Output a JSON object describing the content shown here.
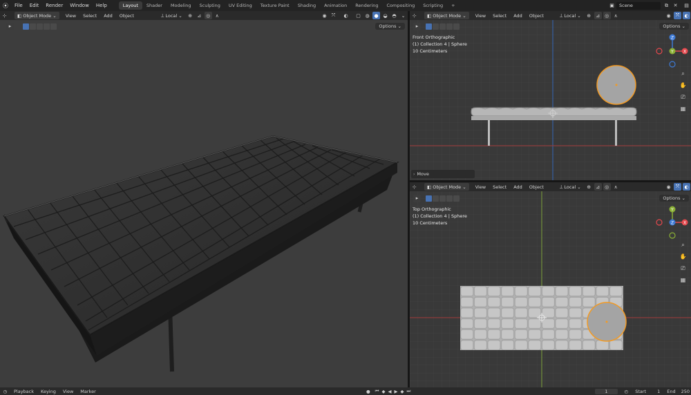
{
  "topbar": {
    "menus": [
      "File",
      "Edit",
      "Render",
      "Window",
      "Help"
    ],
    "workspaces": [
      "Layout",
      "Shader",
      "Modeling",
      "Sculpting",
      "UV Editing",
      "Texture Paint",
      "Shading",
      "Animation",
      "Rendering",
      "Compositing",
      "Scripting"
    ],
    "active_workspace": "Layout",
    "add_tab": "+",
    "scene_name": "Scene"
  },
  "viewport_header": {
    "mode": "Object Mode",
    "menus": [
      "View",
      "Select",
      "Add",
      "Object"
    ],
    "transform": "Local",
    "options": "Options"
  },
  "front_view": {
    "title": "Front Orthographic",
    "collection": "(1) Collection 4 | Sphere",
    "scale": "10 Centimeters",
    "operator_panel": "Move"
  },
  "top_view": {
    "title": "Top Orthographic",
    "collection": "(1) Collection 4 | Sphere",
    "scale": "10 Centimeters"
  },
  "gizmo": {
    "x": "X",
    "y": "Y",
    "z": "Z",
    "colors": {
      "x": "#e5484d",
      "y": "#8bb135",
      "z": "#3d7ad6"
    }
  },
  "timeline": {
    "menus": [
      "Playback",
      "Keying",
      "View",
      "Marker"
    ],
    "current_frame": "1",
    "start_label": "Start",
    "start": "1",
    "end_label": "End",
    "end": "250"
  },
  "colors": {
    "accent": "#4772b3",
    "selection": "#f29a24",
    "viewport_bg": "#3d3d3d"
  }
}
